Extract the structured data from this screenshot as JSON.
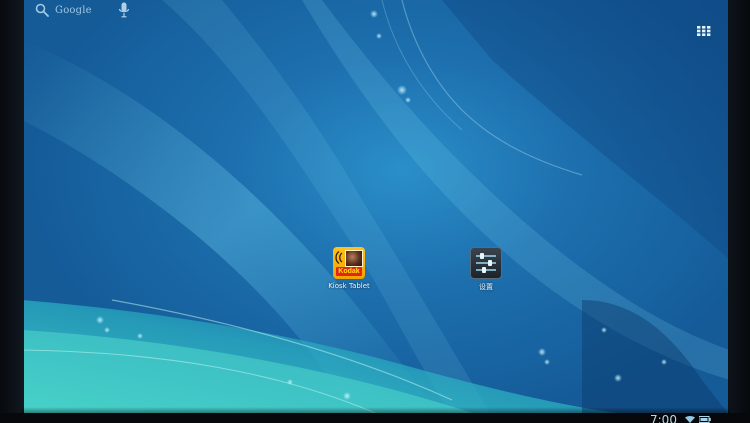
{
  "search": {
    "google_label": "Google",
    "search_icon": "search-icon",
    "mic_icon": "microphone-icon"
  },
  "launcher": {
    "apps_icon": "all-apps-grid-icon"
  },
  "desktop": {
    "apps": [
      {
        "label": "Kiosk Tablet",
        "icon": "kodak-kiosk-icon",
        "brand": "Kodak"
      },
      {
        "label": "设置",
        "icon": "settings-sliders-icon"
      }
    ]
  },
  "status_bar": {
    "time": "7:00",
    "wifi_icon": "wifi-icon",
    "battery_icon": "battery-icon"
  },
  "colors": {
    "wallpaper_deep": "#145b98",
    "wallpaper_mid": "#2a8fc8",
    "wallpaper_teal": "#3fc7c4",
    "kodak_yellow": "#f3a300",
    "kodak_red": "#e1251b",
    "settings_bg": "#1c232b"
  }
}
